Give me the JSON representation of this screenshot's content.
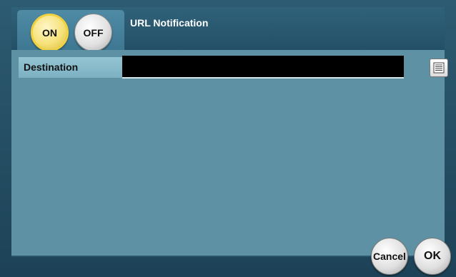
{
  "header": {
    "title": "URL Notification",
    "toggle": {
      "on_label": "ON",
      "off_label": "OFF",
      "selected": "ON"
    }
  },
  "form": {
    "destination_label": "Destination",
    "destination_value": "",
    "list_icon": "list-icon"
  },
  "footer": {
    "cancel_label": "Cancel",
    "ok_label": "OK"
  },
  "colors": {
    "header_bg": "#2f6279",
    "panel_bg": "#5f91a5",
    "selected_toggle": "#f6e27a",
    "field_bg": "#000000"
  }
}
